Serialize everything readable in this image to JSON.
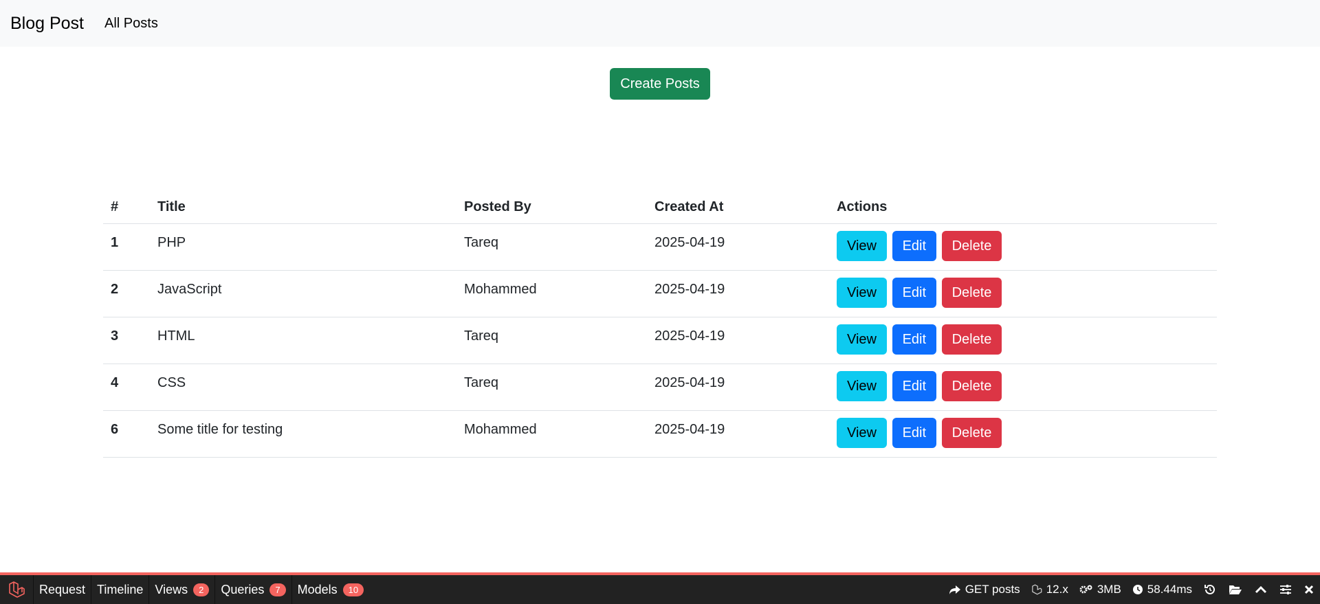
{
  "navbar": {
    "brand": "Blog Post",
    "link": "All Posts"
  },
  "main": {
    "create_button": "Create Posts",
    "table": {
      "headers": [
        "#",
        "Title",
        "Posted By",
        "Created At",
        "Actions"
      ],
      "rows": [
        {
          "id": "1",
          "title": "PHP",
          "posted_by": "Tareq",
          "created_at": "2025-04-19"
        },
        {
          "id": "2",
          "title": "JavaScript",
          "posted_by": "Mohammed",
          "created_at": "2025-04-19"
        },
        {
          "id": "3",
          "title": "HTML",
          "posted_by": "Tareq",
          "created_at": "2025-04-19"
        },
        {
          "id": "4",
          "title": "CSS",
          "posted_by": "Tareq",
          "created_at": "2025-04-19"
        },
        {
          "id": "6",
          "title": "Some title for testing",
          "posted_by": "Mohammed",
          "created_at": "2025-04-19"
        }
      ],
      "actions": {
        "view": "View",
        "edit": "Edit",
        "delete": "Delete"
      }
    }
  },
  "debugbar": {
    "tabs": [
      {
        "label": "Request"
      },
      {
        "label": "Timeline"
      },
      {
        "label": "Views",
        "badge": "2"
      },
      {
        "label": "Queries",
        "badge": "7"
      },
      {
        "label": "Models",
        "badge": "10"
      }
    ],
    "route": "GET posts",
    "version": "12.x",
    "memory": "3MB",
    "time": "58.44ms"
  },
  "colors": {
    "success": "#198754",
    "info": "#0dcaf0",
    "primary": "#0d6efd",
    "danger": "#dc3545",
    "debug_accent": "#f4645f"
  }
}
